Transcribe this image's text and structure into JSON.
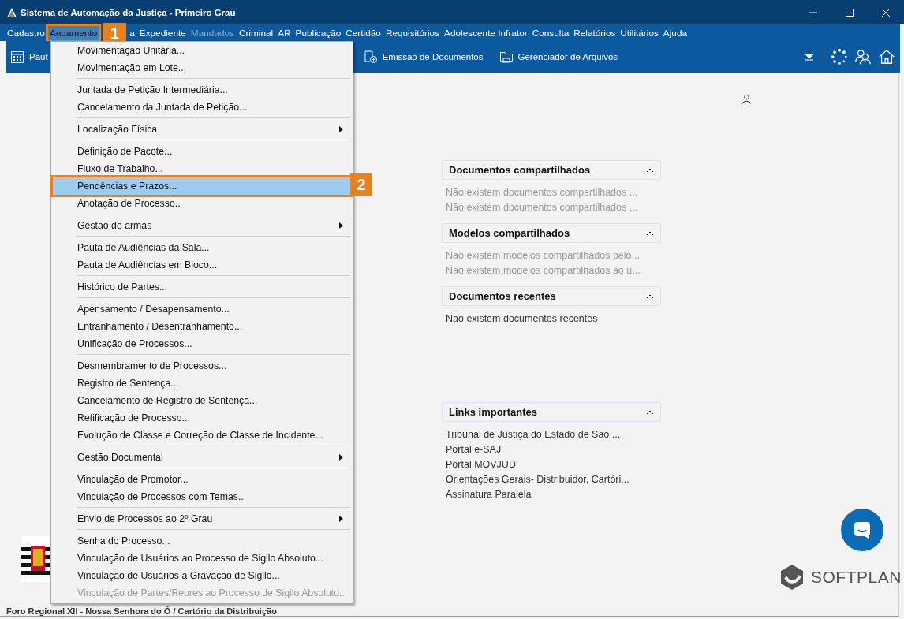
{
  "window": {
    "title": "Sistema de Automação da Justiça - Primeiro Grau"
  },
  "menu_bar": [
    {
      "label": "Cadastro",
      "selected": false,
      "disabled": false
    },
    {
      "label": "Andamento",
      "selected": true,
      "disabled": false
    },
    {
      "label": "a",
      "selected": false,
      "disabled": false
    },
    {
      "label": "Expediente",
      "selected": false,
      "disabled": false
    },
    {
      "label": "Mandados",
      "selected": false,
      "disabled": true
    },
    {
      "label": "Criminal",
      "selected": false,
      "disabled": false
    },
    {
      "label": "AR",
      "selected": false,
      "disabled": false
    },
    {
      "label": "Publicação",
      "selected": false,
      "disabled": false
    },
    {
      "label": "Certidão",
      "selected": false,
      "disabled": false
    },
    {
      "label": "Requisitórios",
      "selected": false,
      "disabled": false
    },
    {
      "label": "Adolescente Infrator",
      "selected": false,
      "disabled": false
    },
    {
      "label": "Consulta",
      "selected": false,
      "disabled": false
    },
    {
      "label": "Relatórios",
      "selected": false,
      "disabled": false
    },
    {
      "label": "Utilitários",
      "selected": false,
      "disabled": false
    },
    {
      "label": "Ajuda",
      "selected": false,
      "disabled": false
    }
  ],
  "toolbar": [
    {
      "label": "Paut",
      "kind": "calendar"
    },
    {
      "label": "Emissão de Documentos",
      "kind": "document"
    },
    {
      "label": "Gerenciador de Arquivos",
      "kind": "folder"
    }
  ],
  "dropdown_menu": [
    [
      {
        "label": "Movimentação Unitária...",
        "selected": false,
        "disabled": false,
        "submenu": false
      },
      {
        "label": "Movimentação em Lote...",
        "selected": false,
        "disabled": false,
        "submenu": false
      }
    ],
    [
      {
        "label": "Juntada de Petição Intermediária...",
        "selected": false,
        "disabled": false,
        "submenu": false
      },
      {
        "label": "Cancelamento da Juntada de Petição...",
        "selected": false,
        "disabled": false,
        "submenu": false
      }
    ],
    [
      {
        "label": "Localização Física",
        "selected": false,
        "disabled": false,
        "submenu": true
      }
    ],
    [
      {
        "label": "Definição de Pacote...",
        "selected": false,
        "disabled": false,
        "submenu": false
      },
      {
        "label": "Fluxo de Trabalho...",
        "selected": false,
        "disabled": false,
        "submenu": false
      },
      {
        "label": "Pendências e Prazos...",
        "selected": true,
        "disabled": false,
        "submenu": false
      },
      {
        "label": "Anotação de Processo..",
        "selected": false,
        "disabled": false,
        "submenu": false
      }
    ],
    [
      {
        "label": "Gestão de armas",
        "selected": false,
        "disabled": false,
        "submenu": true
      }
    ],
    [
      {
        "label": "Pauta de Audiências da Sala...",
        "selected": false,
        "disabled": false,
        "submenu": false
      },
      {
        "label": "Pauta de Audiências em Bloco...",
        "selected": false,
        "disabled": false,
        "submenu": false
      }
    ],
    [
      {
        "label": "Histórico de Partes...",
        "selected": false,
        "disabled": false,
        "submenu": false
      }
    ],
    [
      {
        "label": "Apensamento / Desapensamento...",
        "selected": false,
        "disabled": false,
        "submenu": false
      },
      {
        "label": "Entranhamento / Desentranhamento...",
        "selected": false,
        "disabled": false,
        "submenu": false
      },
      {
        "label": "Unificação de Processos...",
        "selected": false,
        "disabled": false,
        "submenu": false
      }
    ],
    [
      {
        "label": "Desmembramento de Processos...",
        "selected": false,
        "disabled": false,
        "submenu": false
      },
      {
        "label": "Registro de Sentença...",
        "selected": false,
        "disabled": false,
        "submenu": false
      },
      {
        "label": "Cancelamento de Registro de Sentença...",
        "selected": false,
        "disabled": false,
        "submenu": false
      },
      {
        "label": "Retificação de Processo...",
        "selected": false,
        "disabled": false,
        "submenu": false
      },
      {
        "label": "Evolução de Classe e Correção de Classe de Incidente...",
        "selected": false,
        "disabled": false,
        "submenu": false
      }
    ],
    [
      {
        "label": "Gestão Documental",
        "selected": false,
        "disabled": false,
        "submenu": true
      }
    ],
    [
      {
        "label": "Vinculação de Promotor...",
        "selected": false,
        "disabled": false,
        "submenu": false
      },
      {
        "label": "Vinculação de Processos com Temas...",
        "selected": false,
        "disabled": false,
        "submenu": false
      }
    ],
    [
      {
        "label": "Envio de Processos ao 2º Grau",
        "selected": false,
        "disabled": false,
        "submenu": true
      }
    ],
    [
      {
        "label": "Senha do Processo...",
        "selected": false,
        "disabled": false,
        "submenu": false
      },
      {
        "label": "Vinculação de Usuários ao Processo de Sigilo Absoluto...",
        "selected": false,
        "disabled": false,
        "submenu": false
      },
      {
        "label": "Vinculação de Usuários a Gravação de Sigilo...",
        "selected": false,
        "disabled": false,
        "submenu": false
      },
      {
        "label": "Vinculação de Partes/Repres ao Processo de Sigilo Absoluto..",
        "selected": false,
        "disabled": true,
        "submenu": false
      }
    ]
  ],
  "callouts": [
    {
      "label": "1"
    },
    {
      "label": "2"
    }
  ],
  "panels": [
    {
      "title": "Documentos compartilhados",
      "expanded": true,
      "lines": [
        {
          "text": "Não existem documentos compartilhados ...",
          "muted": true
        },
        {
          "text": "Não existem documentos compartilhados ...",
          "muted": true
        }
      ]
    },
    {
      "title": "Modelos compartilhados",
      "expanded": true,
      "lines": [
        {
          "text": "Não existem modelos compartilhados pelo...",
          "muted": true
        },
        {
          "text": "Não existem modelos compartilhados ao u...",
          "muted": true
        }
      ]
    },
    {
      "title": "Documentos recentes",
      "expanded": true,
      "lines": [
        {
          "text": "Não existem documentos recentes",
          "muted": false
        }
      ]
    },
    {
      "title": "Links importantes",
      "expanded": true,
      "lines": [
        {
          "text": "Tribunal de Justiça do Estado de São ...",
          "muted": false
        },
        {
          "text": "Portal e-SAJ",
          "muted": false
        },
        {
          "text": "Portal MOVJUD",
          "muted": false
        },
        {
          "text": "Orientações Gerais- Distribuidor, Cartóri...",
          "muted": false
        },
        {
          "text": "Assinatura Paralela",
          "muted": false
        }
      ]
    }
  ],
  "brand": {
    "name": "SOFTPLAN"
  },
  "status_bar": {
    "text": "Foro Regional XII - Nossa Senhora do Ó / Cartório da Distribuição"
  }
}
